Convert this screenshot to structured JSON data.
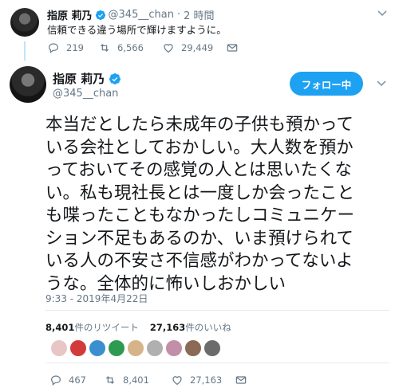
{
  "parent_tweet": {
    "name": "指原 莉乃",
    "handle": "@345__chan",
    "separator": "·",
    "time": "2 時間",
    "text": "信頼できる違う場所で輝けますように。",
    "replies": "219",
    "retweets": "6,566",
    "likes": "29,449"
  },
  "main_tweet": {
    "name": "指原 莉乃",
    "handle": "@345__chan",
    "follow_label": "フォロー中",
    "text_lines": [
      "本当だとしたら未成年の子供も預かって",
      "いる会社としておかしい。大人数を預か",
      "っておいてその感覚の人とは思いたくな",
      "い。私も現社長とは一度しか会ったこと",
      "も喋ったこともなかったしコミュニケー",
      "ション不足もあるのか、いま預けられて",
      "いる人の不安さ不信感がわかってないよ",
      "うな。全体的に怖いしおかしい"
    ],
    "timestamp": "9:33 - 2019年4月22日",
    "retweet_count": "8,401",
    "retweet_label": "件のリツイート",
    "like_count": "27,163",
    "like_label": "件のいいね",
    "replies": "467",
    "retweets": "8,401",
    "likes": "27,163"
  },
  "icons": {
    "verified": "verified-badge-icon",
    "caret": "chevron-down-icon",
    "reply": "reply-icon",
    "retweet": "retweet-icon",
    "like": "heart-icon",
    "dm": "envelope-icon"
  },
  "colors": {
    "accent": "#1da1f2",
    "text": "#14171a",
    "muted": "#657786",
    "divider": "#e6ecf0"
  },
  "liker_colors": [
    "#e8c6c6",
    "#d33b3b",
    "#3c8fcf",
    "#2e9a51",
    "#d6b48a",
    "#b0b0b0",
    "#c28ea8",
    "#8a6a55",
    "#6b6b6b"
  ]
}
